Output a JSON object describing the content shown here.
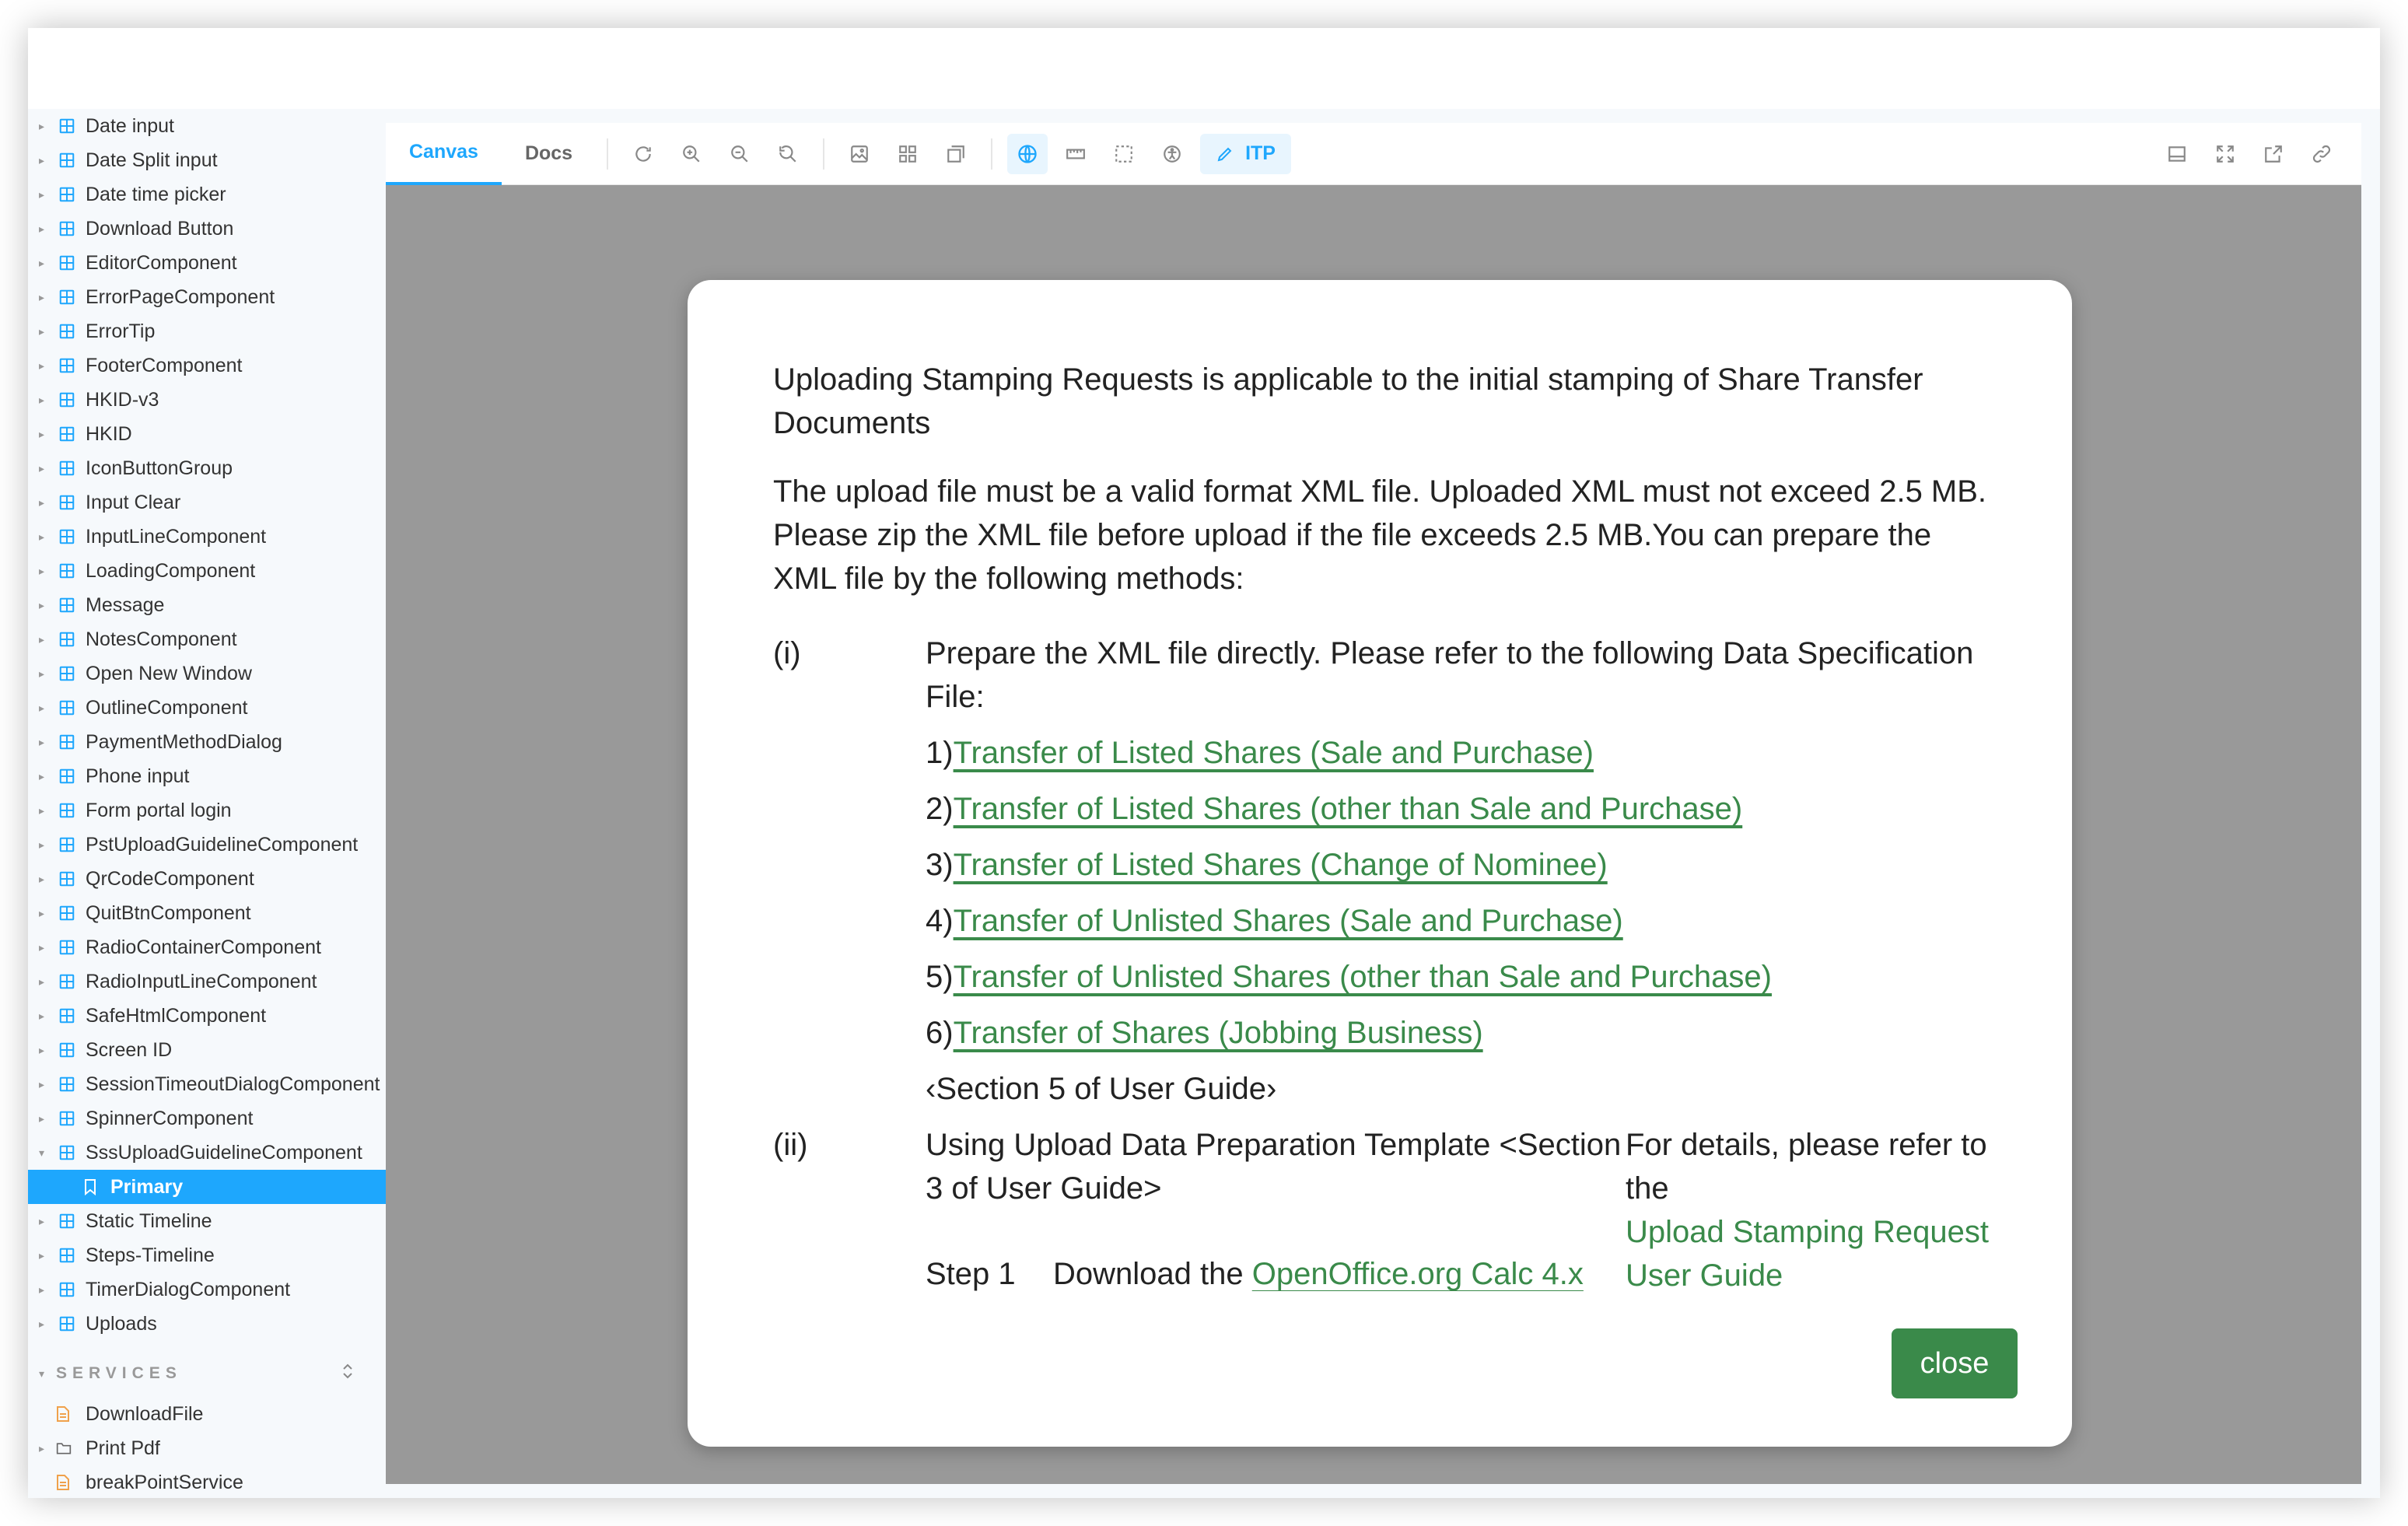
{
  "sidebar": {
    "components": [
      "Date input",
      "Date Split input",
      "Date time picker",
      "Download Button",
      "EditorComponent",
      "ErrorPageComponent",
      "ErrorTip",
      "FooterComponent",
      "HKID-v3",
      "HKID",
      "IconButtonGroup",
      "Input Clear",
      "InputLineComponent",
      "LoadingComponent",
      "Message",
      "NotesComponent",
      "Open New Window",
      "OutlineComponent",
      "PaymentMethodDialog",
      "Phone input",
      "Form portal login",
      "PstUploadGuidelineComponent",
      "QrCodeComponent",
      "QuitBtnComponent",
      "RadioContainerComponent",
      "RadioInputLineComponent",
      "SafeHtmlComponent",
      "Screen ID",
      "SessionTimeoutDialogComponent",
      "SpinnerComponent",
      "SssUploadGuidelineComponent"
    ],
    "selected_story": "Primary",
    "components_after": [
      "Static Timeline",
      "Steps-Timeline",
      "TimerDialogComponent",
      "Uploads"
    ],
    "services_header": "SERVICES",
    "services": [
      {
        "label": "DownloadFile",
        "type": "file"
      },
      {
        "label": "Print Pdf",
        "type": "folder"
      },
      {
        "label": "breakPointService",
        "type": "file"
      }
    ]
  },
  "toolbar": {
    "tabs": [
      "Canvas",
      "Docs"
    ],
    "itp_label": "ITP",
    "icons_left": [
      "reload-icon",
      "zoom-in-icon",
      "zoom-out-icon",
      "zoom-reset-icon",
      "background-icon",
      "grid-icon",
      "outline-icon",
      "locale-icon",
      "measure-icon",
      "viewport-icon",
      "accessibility-icon"
    ],
    "icons_right": [
      "panel-icon",
      "fullscreen-icon",
      "open-new-tab-icon",
      "copy-link-icon"
    ]
  },
  "dialog": {
    "intro": "Uploading Stamping Requests is applicable to the initial stamping of Share Transfer Documents",
    "paragraph": "The upload file must be a valid format XML file. Uploaded XML must not exceed 2.5 MB. Please zip the XML file before upload if the file exceeds 2.5 MB.You can prepare the XML file by the following methods:",
    "method1": {
      "num": "(i)",
      "text": "Prepare the XML file directly. Please refer to the following Data Specification File:",
      "links": [
        {
          "prefix": "1)",
          "text": "Transfer of Listed Shares (Sale and Purchase)"
        },
        {
          "prefix": "2)",
          "text": "Transfer of Listed Shares (other than Sale and Purchase)"
        },
        {
          "prefix": "3)",
          "text": "Transfer of Listed Shares (Change of Nominee)"
        },
        {
          "prefix": "4)",
          "text": "Transfer of Unlisted Shares (Sale and Purchase)"
        },
        {
          "prefix": "5)",
          "text": "Transfer of Unlisted Shares (other than Sale and Purchase)"
        },
        {
          "prefix": "6)",
          "text": "Transfer of Shares (Jobbing Business)"
        }
      ],
      "guide_ref": "‹Section 5 of User Guide›"
    },
    "method2": {
      "num": "(ii)",
      "text": "Using Upload Data Preparation Template <Section 3 of User Guide>",
      "details_text": "For details, please refer to the",
      "details_link": "Upload Stamping Request User Guide",
      "step_label": "Step 1",
      "step_text": "Download the",
      "step_link": "OpenOffice.org Calc 4.x"
    },
    "close_label": "close"
  },
  "colors": {
    "accent": "#1ea7fd",
    "link_green": "#3a8a4a",
    "canvas_bg": "#999999"
  }
}
